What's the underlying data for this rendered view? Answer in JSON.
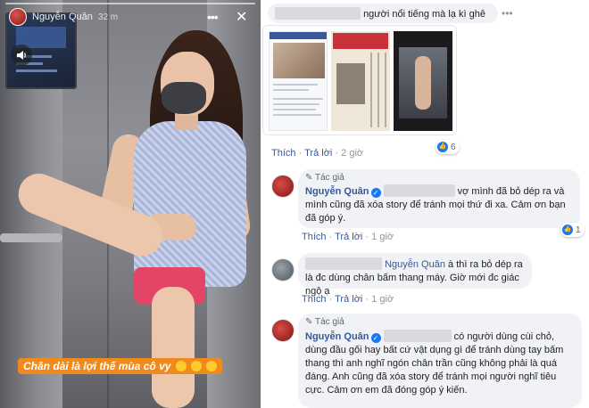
{
  "story": {
    "user_name": "Nguyễn Quân",
    "time_ago": "32 m",
    "caption": "Chân dài là lợi thế mùa cô vy",
    "caption_emojis": [
      "grinning-squinting-face",
      "grinning-squinting-face",
      "grinning-squinting-face"
    ],
    "icons": [
      "more-icon",
      "close-icon",
      "sound-icon"
    ]
  },
  "comments": [
    {
      "id": "c1",
      "text": "người nổi tiếng mà lạ kì ghê",
      "attachment": "screenshot-collage",
      "actions": {
        "like": "Thích",
        "reply": "Trả lời",
        "time": "2 giờ"
      },
      "reaction_count": "6"
    },
    {
      "id": "c2",
      "author_badge": "Tác giả",
      "author": "Nguyễn Quân",
      "text": "vợ mình đã bỏ dép ra và mình cũng đã xóa story để tránh mọi thứ đi xa. Cảm ơn bạn đã góp ý.",
      "actions": {
        "like": "Thích",
        "reply": "Trả lời",
        "time": "1 giờ"
      },
      "reaction_count": "1"
    },
    {
      "id": "c3",
      "mention": "Nguyễn Quân",
      "text": "à thì ra bỏ dép ra là đc dùng chân bấm thang máy. Giờ mới đc giác ngộ ạ",
      "actions": {
        "like": "Thích",
        "reply": "Trả lời",
        "time": "1 giờ"
      }
    },
    {
      "id": "c4",
      "author_badge": "Tác giả",
      "author": "Nguyễn Quân",
      "text": "có người dùng cùi chỏ, dùng đầu gối hay bất cứ vật dụng gì để tránh dùng tay bấm thang thì anh nghĩ ngón chân trần cũng không phải là quá đáng. Anh cũng đã xóa story để tránh mọi người nghĩ tiêu cực. Cảm ơn em đã đóng góp ý kiến."
    }
  ]
}
